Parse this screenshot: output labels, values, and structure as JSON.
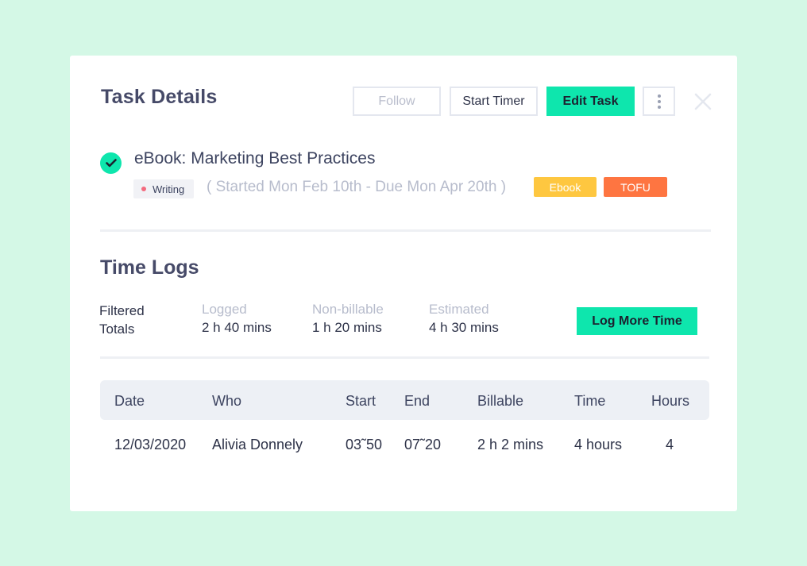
{
  "header": {
    "title": "Task Details",
    "follow_label": "Follow",
    "start_timer_label": "Start Timer",
    "edit_task_label": "Edit Task",
    "more_icon": "vertical-ellipsis-icon",
    "close_icon": "close-icon"
  },
  "task": {
    "name": "eBook: Marketing Best Practices",
    "completed": true,
    "status": "Writing",
    "dates": "( Started Mon Feb 10th - Due Mon Apr 20th )",
    "tags": [
      {
        "label": "Ebook",
        "color": "#fec740"
      },
      {
        "label": "TOFU",
        "color": "#fe7541"
      }
    ]
  },
  "time_logs": {
    "title": "Time Logs",
    "totals_label_line1": "Filtered",
    "totals_label_line2": "Totals",
    "stats": [
      {
        "label": "Logged",
        "value": "2 h 40 mins"
      },
      {
        "label": "Non-billable",
        "value": "1 h 20 mins"
      },
      {
        "label": "Estimated",
        "value": "4 h 30 mins"
      }
    ],
    "log_more_label": "Log More Time"
  },
  "table": {
    "columns": [
      "Date",
      "Who",
      "Start",
      "End",
      "Billable",
      "Time",
      "Hours"
    ],
    "rows": [
      [
        "12/03/2020",
        "Alivia Donnely",
        "03˜50",
        "07˜20",
        "2 h 2 mins",
        "4 hours",
        "4"
      ]
    ]
  },
  "colors": {
    "background": "#d4f8e6",
    "accent": "#0ee6ad",
    "status_dot": "#f36b7f"
  }
}
